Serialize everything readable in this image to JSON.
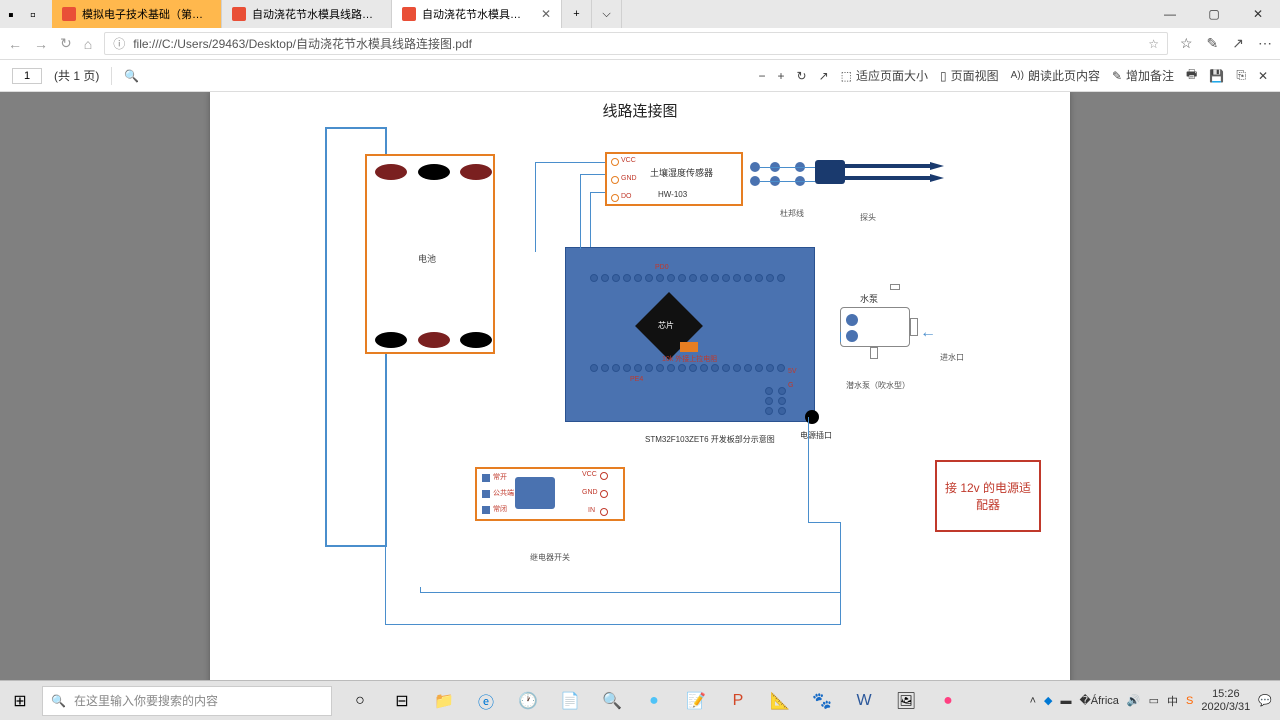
{
  "tabs": [
    {
      "label": "模拟电子技术基础（第五版"
    },
    {
      "label": "自动浇花节水模具线路连接"
    },
    {
      "label": "自动浇花节水模具线路连"
    }
  ],
  "url": "file:///C:/Users/29463/Desktop/自动浇花节水模具线路连接图.pdf",
  "page_input": "1",
  "page_total": "(共 1 页)",
  "toolbar": {
    "fit": "适应页面大小",
    "pageview": "页面视图",
    "read": "朗读此页内容",
    "note": "增加备注"
  },
  "diagram": {
    "title": "线路连接图",
    "battery": "电池",
    "sensor_title": "土壤湿度传感器",
    "sensor_model": "HW-103",
    "sensor_pins": {
      "vcc": "VCC",
      "gnd": "GND",
      "do": "DO"
    },
    "dupont": "杜邦线",
    "probe": "探头",
    "chip": "芯片",
    "resistor": "10k 外接上拉电阻",
    "mcu": "STM32F103ZET6 开发板部分示意图",
    "mcu_pins": {
      "pd0": "PD0",
      "pe4": "PE4",
      "v5": "5V",
      "gnd": "G"
    },
    "pump": "水泵",
    "pump_sub": "潜水泵（吹水型）",
    "water_in": "进水口",
    "power_port": "电源插口",
    "relay": "继电器开关",
    "relay_pins": {
      "no": "常开",
      "com": "公共端",
      "nc": "常闭",
      "vcc": "VCC",
      "gnd": "GND",
      "in": "IN"
    },
    "adapter": "接 12v 的电源适配器"
  },
  "search_placeholder": "在这里输入你要搜索的内容",
  "clock": {
    "time": "15:26",
    "date": "2020/3/31"
  }
}
